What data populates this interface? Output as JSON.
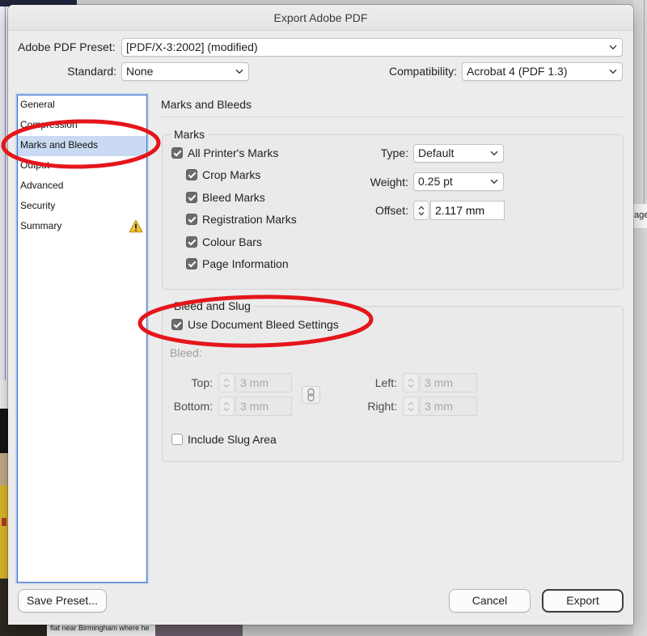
{
  "window": {
    "title": "Export Adobe PDF"
  },
  "header": {
    "preset_label": "Adobe PDF Preset:",
    "preset_value": "[PDF/X-3:2002] (modified)",
    "standard_label": "Standard:",
    "standard_value": "None",
    "compatibility_label": "Compatibility:",
    "compatibility_value": "Acrobat 4 (PDF 1.3)"
  },
  "sidebar": {
    "items": [
      {
        "label": "General",
        "selected": false
      },
      {
        "label": "Compression",
        "selected": false
      },
      {
        "label": "Marks and Bleeds",
        "selected": true
      },
      {
        "label": "Output",
        "selected": false
      },
      {
        "label": "Advanced",
        "selected": false
      },
      {
        "label": "Security",
        "selected": false
      },
      {
        "label": "Summary",
        "selected": false,
        "icon": "warning-icon"
      }
    ]
  },
  "panel": {
    "title": "Marks and Bleeds"
  },
  "marks": {
    "legend": "Marks",
    "all": {
      "label": "All Printer's Marks",
      "checked": true
    },
    "options": [
      {
        "label": "Crop Marks",
        "checked": true
      },
      {
        "label": "Bleed Marks",
        "checked": true
      },
      {
        "label": "Registration Marks",
        "checked": true
      },
      {
        "label": "Colour Bars",
        "checked": true
      },
      {
        "label": "Page Information",
        "checked": true
      }
    ],
    "type_label": "Type:",
    "type_value": "Default",
    "weight_label": "Weight:",
    "weight_value": "0.25 pt",
    "offset_label": "Offset:",
    "offset_value": "2.117 mm"
  },
  "bleed_slug": {
    "legend": "Bleed and Slug",
    "use_document": {
      "label": "Use Document Bleed Settings",
      "checked": true
    },
    "bleed_label": "Bleed:",
    "top_label": "Top:",
    "top_value": "3 mm",
    "bottom_label": "Bottom:",
    "bottom_value": "3 mm",
    "left_label": "Left:",
    "left_value": "3 mm",
    "right_label": "Right:",
    "right_value": "3 mm",
    "link_icon": "chain-link-icon",
    "include_slug": {
      "label": "Include Slug Area",
      "checked": false
    }
  },
  "footer": {
    "save_preset": "Save Preset...",
    "cancel": "Cancel",
    "export": "Export"
  },
  "colors": {
    "annotation": "#e4161c",
    "selection": "#c9daf2",
    "focus_ring": "#3d74d8",
    "warning": "#f2c12e"
  },
  "background": {
    "side_tab_text": "age",
    "bottom_text": "flat near Birmingham where he"
  }
}
